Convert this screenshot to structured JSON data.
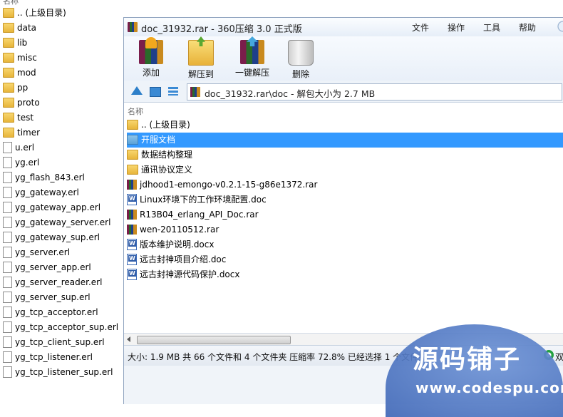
{
  "background_list": {
    "header": "名称",
    "items": [
      {
        "name": ".. (上级目录)",
        "type": "folder"
      },
      {
        "name": "data",
        "type": "folder"
      },
      {
        "name": "lib",
        "type": "folder"
      },
      {
        "name": "misc",
        "type": "folder"
      },
      {
        "name": "mod",
        "type": "folder"
      },
      {
        "name": "pp",
        "type": "folder"
      },
      {
        "name": "proto",
        "type": "folder"
      },
      {
        "name": "test",
        "type": "folder"
      },
      {
        "name": "timer",
        "type": "folder"
      },
      {
        "name": "u.erl",
        "type": "file"
      },
      {
        "name": "yg.erl",
        "type": "file"
      },
      {
        "name": "yg_flash_843.erl",
        "type": "file"
      },
      {
        "name": "yg_gateway.erl",
        "type": "file"
      },
      {
        "name": "yg_gateway_app.erl",
        "type": "file"
      },
      {
        "name": "yg_gateway_server.erl",
        "type": "file"
      },
      {
        "name": "yg_gateway_sup.erl",
        "type": "file"
      },
      {
        "name": "yg_server.erl",
        "type": "file"
      },
      {
        "name": "yg_server_app.erl",
        "type": "file"
      },
      {
        "name": "yg_server_reader.erl",
        "type": "file"
      },
      {
        "name": "yg_server_sup.erl",
        "type": "file"
      },
      {
        "name": "yg_tcp_acceptor.erl",
        "type": "file"
      },
      {
        "name": "yg_tcp_acceptor_sup.erl",
        "type": "file"
      },
      {
        "name": "yg_tcp_client_sup.erl",
        "type": "file"
      },
      {
        "name": "yg_tcp_listener.erl",
        "type": "file"
      },
      {
        "name": "yg_tcp_listener_sup.erl",
        "type": "file"
      }
    ]
  },
  "window": {
    "title": "doc_31932.rar - 360压缩 3.0 正式版",
    "menu": [
      "文件",
      "操作",
      "工具",
      "帮助"
    ]
  },
  "toolbar": {
    "add_label": "添加",
    "extract_label": "解压到",
    "onekey_label": "一键解压",
    "delete_label": "删除"
  },
  "address": {
    "text": "doc_31932.rar\\doc - 解包大小为 2.7 MB"
  },
  "file_list": {
    "header": "名称",
    "rows": [
      {
        "name": ".. (上级目录)",
        "type": "folder"
      },
      {
        "name": "开服文档",
        "type": "folder-blue",
        "selected": true
      },
      {
        "name": "数据结构整理",
        "type": "folder"
      },
      {
        "name": "通讯协议定义",
        "type": "folder"
      },
      {
        "name": "jdhood1-emongo-v0.2.1-15-g86e1372.rar",
        "type": "rar"
      },
      {
        "name": "Linux环境下的工作环境配置.doc",
        "type": "doc"
      },
      {
        "name": "R13B04_erlang_API_Doc.rar",
        "type": "rar"
      },
      {
        "name": "wen-20110512.rar",
        "type": "rar"
      },
      {
        "name": "版本维护说明.docx",
        "type": "doc"
      },
      {
        "name": "远古封神项目介绍.doc",
        "type": "doc"
      },
      {
        "name": "远古封神源代码保护.docx",
        "type": "doc"
      }
    ]
  },
  "status": {
    "text": "大小: 1.9 MB 共 66 个文件和 4 个文件夹 压缩率 72.8% 已经选择 1 个文件夹",
    "extra": "双"
  },
  "watermark": {
    "title": "源码铺子",
    "url": "www.codespu.com"
  }
}
